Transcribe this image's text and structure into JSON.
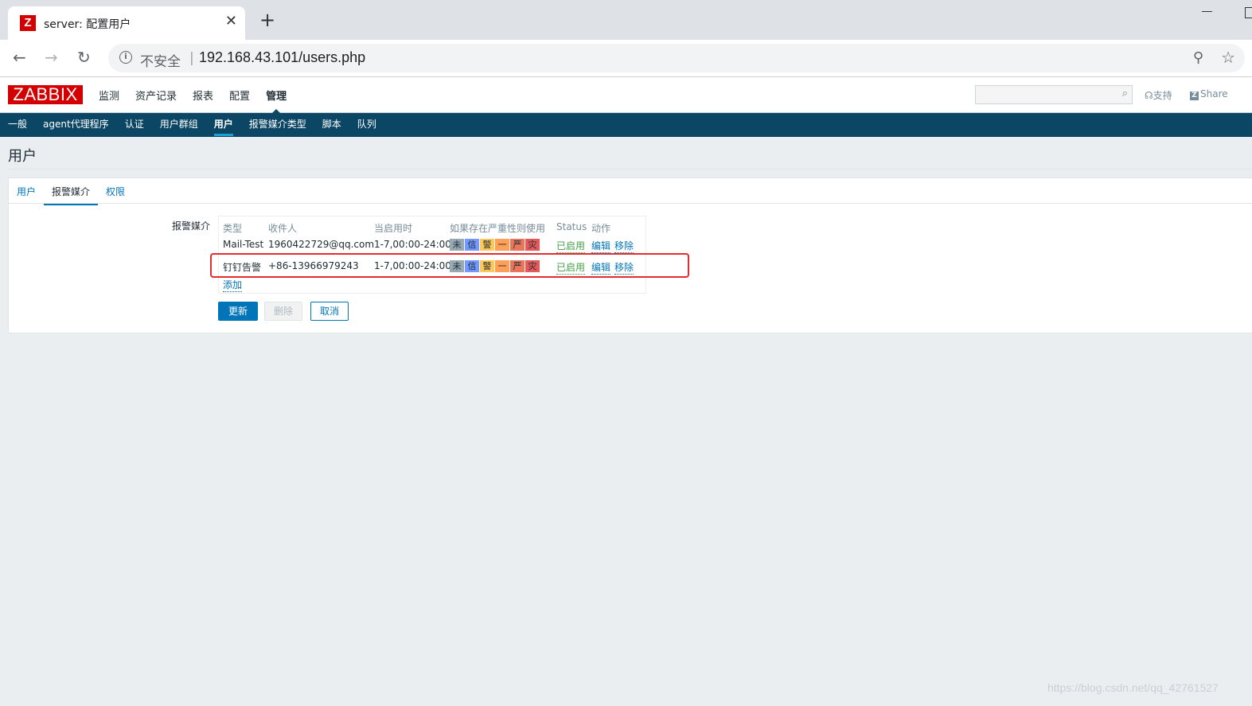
{
  "browser": {
    "tab_title": "server: 配置用户",
    "tab_favicon": "Z",
    "insecure_label": "不安全",
    "url": "192.168.43.101/users.php"
  },
  "header": {
    "logo": "ZABBIX",
    "menu": [
      "监测",
      "资产记录",
      "报表",
      "配置",
      "管理"
    ],
    "active_menu": "管理",
    "support": "支持",
    "share": "Share",
    "search_value": ""
  },
  "subnav": {
    "items": [
      "一般",
      "agent代理程序",
      "认证",
      "用户群组",
      "用户",
      "报警媒介类型",
      "脚本",
      "队列"
    ],
    "active": "用户"
  },
  "page": {
    "title": "用户",
    "tabs": [
      "用户",
      "报警媒介",
      "权限"
    ],
    "active_tab": "报警媒介",
    "media_label": "报警媒介",
    "columns": [
      "类型",
      "收件人",
      "当启用时",
      "如果存在严重性则使用",
      "Status",
      "动作"
    ],
    "rows": [
      {
        "type": "Mail-Test",
        "recipient": "1960422729@qq.com",
        "when": "1-7,00:00-24:00",
        "severities": [
          "未",
          "信",
          "警",
          "一",
          "严",
          "灾"
        ],
        "status": "已启用",
        "edit": "编辑",
        "remove": "移除"
      },
      {
        "type": "钉钉告警",
        "recipient": "+86-13966979243",
        "when": "1-7,00:00-24:00",
        "severities": [
          "未",
          "信",
          "警",
          "一",
          "严",
          "灾"
        ],
        "status": "已启用",
        "edit": "编辑",
        "remove": "移除"
      }
    ],
    "add_link": "添加",
    "buttons": {
      "update": "更新",
      "delete": "删除",
      "cancel": "取消"
    }
  },
  "watermark": "https://blog.csdn.net/qq_42761527",
  "colors": {
    "brand": "#d40000",
    "subnav": "#0b4664",
    "link": "#0275b8",
    "enabled": "#429e47",
    "highlight": "#e52b2b"
  }
}
